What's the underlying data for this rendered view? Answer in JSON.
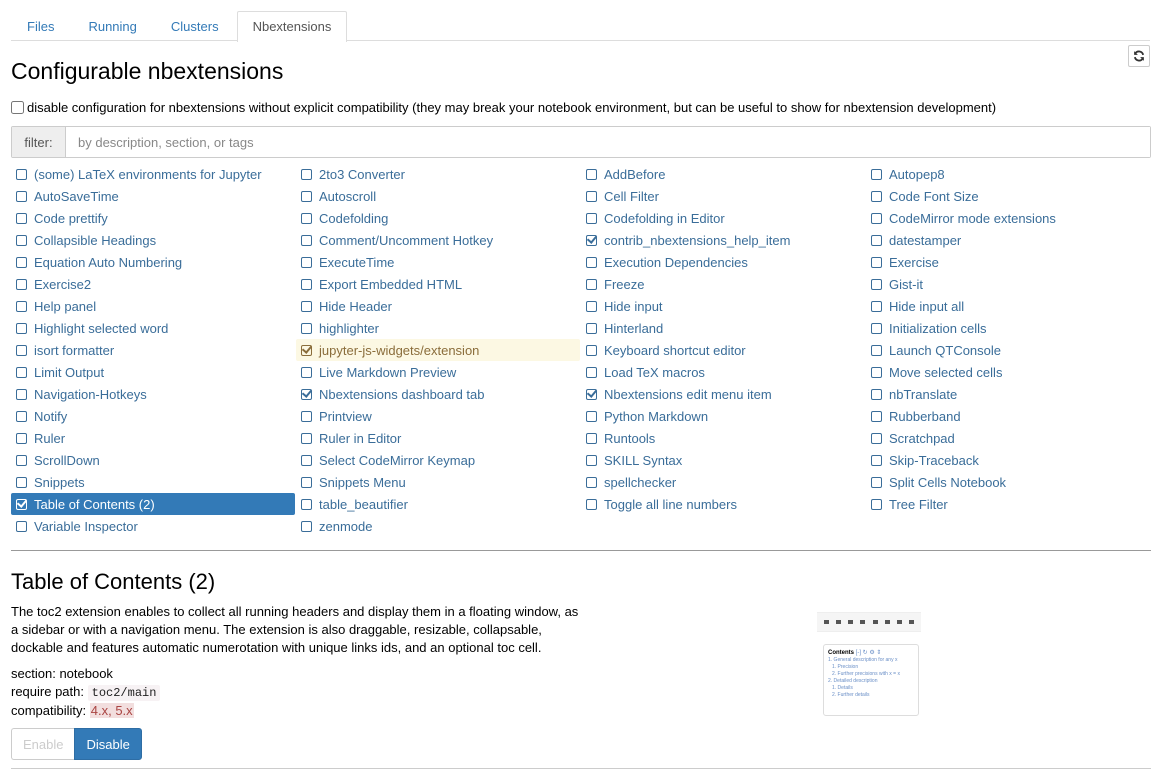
{
  "tabs": [
    {
      "label": "Files",
      "active": false
    },
    {
      "label": "Running",
      "active": false
    },
    {
      "label": "Clusters",
      "active": false
    },
    {
      "label": "Nbextensions",
      "active": true
    }
  ],
  "refresh_icon": "refresh-icon",
  "page_title": "Configurable nbextensions",
  "disable_config": {
    "checked": false,
    "label": "disable configuration for nbextensions without explicit compatibility (they may break your notebook environment, but can be useful to show for nbextension development)"
  },
  "filter": {
    "label": "filter:",
    "value": "",
    "placeholder": "by description, section, or tags"
  },
  "extensions": [
    {
      "label": "(some) LaTeX environments for Jupyter",
      "checked": false,
      "state": ""
    },
    {
      "label": "AutoSaveTime",
      "checked": false,
      "state": ""
    },
    {
      "label": "Code prettify",
      "checked": false,
      "state": ""
    },
    {
      "label": "Collapsible Headings",
      "checked": false,
      "state": ""
    },
    {
      "label": "Equation Auto Numbering",
      "checked": false,
      "state": ""
    },
    {
      "label": "Exercise2",
      "checked": false,
      "state": ""
    },
    {
      "label": "Help panel",
      "checked": false,
      "state": ""
    },
    {
      "label": "Highlight selected word",
      "checked": false,
      "state": ""
    },
    {
      "label": "isort formatter",
      "checked": false,
      "state": ""
    },
    {
      "label": "Limit Output",
      "checked": false,
      "state": ""
    },
    {
      "label": "Navigation-Hotkeys",
      "checked": false,
      "state": ""
    },
    {
      "label": "Notify",
      "checked": false,
      "state": ""
    },
    {
      "label": "Ruler",
      "checked": false,
      "state": ""
    },
    {
      "label": "ScrollDown",
      "checked": false,
      "state": ""
    },
    {
      "label": "Snippets",
      "checked": false,
      "state": ""
    },
    {
      "label": "Table of Contents (2)",
      "checked": true,
      "state": "selected"
    },
    {
      "label": "Variable Inspector",
      "checked": false,
      "state": ""
    },
    {
      "label": "2to3 Converter",
      "checked": false,
      "state": ""
    },
    {
      "label": "Autoscroll",
      "checked": false,
      "state": ""
    },
    {
      "label": "Codefolding",
      "checked": false,
      "state": ""
    },
    {
      "label": "Comment/Uncomment Hotkey",
      "checked": false,
      "state": ""
    },
    {
      "label": "ExecuteTime",
      "checked": false,
      "state": ""
    },
    {
      "label": "Export Embedded HTML",
      "checked": false,
      "state": ""
    },
    {
      "label": "Hide Header",
      "checked": false,
      "state": ""
    },
    {
      "label": "highlighter",
      "checked": false,
      "state": ""
    },
    {
      "label": "jupyter-js-widgets/extension",
      "checked": true,
      "state": "warning"
    },
    {
      "label": "Live Markdown Preview",
      "checked": false,
      "state": ""
    },
    {
      "label": "Nbextensions dashboard tab",
      "checked": true,
      "state": ""
    },
    {
      "label": "Printview",
      "checked": false,
      "state": ""
    },
    {
      "label": "Ruler in Editor",
      "checked": false,
      "state": ""
    },
    {
      "label": "Select CodeMirror Keymap",
      "checked": false,
      "state": ""
    },
    {
      "label": "Snippets Menu",
      "checked": false,
      "state": ""
    },
    {
      "label": "table_beautifier",
      "checked": false,
      "state": ""
    },
    {
      "label": "zenmode",
      "checked": false,
      "state": ""
    },
    {
      "label": "AddBefore",
      "checked": false,
      "state": ""
    },
    {
      "label": "Cell Filter",
      "checked": false,
      "state": ""
    },
    {
      "label": "Codefolding in Editor",
      "checked": false,
      "state": ""
    },
    {
      "label": "contrib_nbextensions_help_item",
      "checked": true,
      "state": ""
    },
    {
      "label": "Execution Dependencies",
      "checked": false,
      "state": ""
    },
    {
      "label": "Freeze",
      "checked": false,
      "state": ""
    },
    {
      "label": "Hide input",
      "checked": false,
      "state": ""
    },
    {
      "label": "Hinterland",
      "checked": false,
      "state": ""
    },
    {
      "label": "Keyboard shortcut editor",
      "checked": false,
      "state": ""
    },
    {
      "label": "Load TeX macros",
      "checked": false,
      "state": ""
    },
    {
      "label": "Nbextensions edit menu item",
      "checked": true,
      "state": ""
    },
    {
      "label": "Python Markdown",
      "checked": false,
      "state": ""
    },
    {
      "label": "Runtools",
      "checked": false,
      "state": ""
    },
    {
      "label": "SKILL Syntax",
      "checked": false,
      "state": ""
    },
    {
      "label": "spellchecker",
      "checked": false,
      "state": ""
    },
    {
      "label": "Toggle all line numbers",
      "checked": false,
      "state": ""
    },
    {
      "label": "",
      "checked": false,
      "state": "empty"
    },
    {
      "label": "Autopep8",
      "checked": false,
      "state": ""
    },
    {
      "label": "Code Font Size",
      "checked": false,
      "state": ""
    },
    {
      "label": "CodeMirror mode extensions",
      "checked": false,
      "state": ""
    },
    {
      "label": "datestamper",
      "checked": false,
      "state": ""
    },
    {
      "label": "Exercise",
      "checked": false,
      "state": ""
    },
    {
      "label": "Gist-it",
      "checked": false,
      "state": ""
    },
    {
      "label": "Hide input all",
      "checked": false,
      "state": ""
    },
    {
      "label": "Initialization cells",
      "checked": false,
      "state": ""
    },
    {
      "label": "Launch QTConsole",
      "checked": false,
      "state": ""
    },
    {
      "label": "Move selected cells",
      "checked": false,
      "state": ""
    },
    {
      "label": "nbTranslate",
      "checked": false,
      "state": ""
    },
    {
      "label": "Rubberband",
      "checked": false,
      "state": ""
    },
    {
      "label": "Scratchpad",
      "checked": false,
      "state": ""
    },
    {
      "label": "Skip-Traceback",
      "checked": false,
      "state": ""
    },
    {
      "label": "Split Cells Notebook",
      "checked": false,
      "state": ""
    },
    {
      "label": "Tree Filter",
      "checked": false,
      "state": ""
    }
  ],
  "detail": {
    "title": "Table of Contents (2)",
    "description": "The toc2 extension enables to collect all running headers and display them in a floating window, as a sidebar or with a navigation menu. The extension is also draggable, resizable, collapsable, dockable and features automatic numerotation with unique links ids, and an optional toc cell.",
    "section_label": "section:",
    "section_value": "notebook",
    "require_label": "require path:",
    "require_value": "toc2/main",
    "compat_label": "compatibility:",
    "compat_value": "4.x, 5.x",
    "enable_label": "Enable",
    "disable_label": "Disable",
    "preview": {
      "title": "Contents",
      "controls": "[-] ↻ ⚙ ⇕",
      "items": [
        {
          "text": "1. General description for any x",
          "level": 1
        },
        {
          "text": "1. Precision",
          "level": 2
        },
        {
          "text": "2. Further precisions with x = x",
          "level": 2
        },
        {
          "text": "2. Detailed description",
          "level": 1
        },
        {
          "text": "1. Details",
          "level": 2
        },
        {
          "text": "2. Further details",
          "level": 2
        }
      ]
    }
  },
  "colors": {
    "link": "#337ab7",
    "selected_bg": "#337ab7",
    "warning_bg": "#fcf8e3",
    "compat_bg": "#f2dede"
  }
}
